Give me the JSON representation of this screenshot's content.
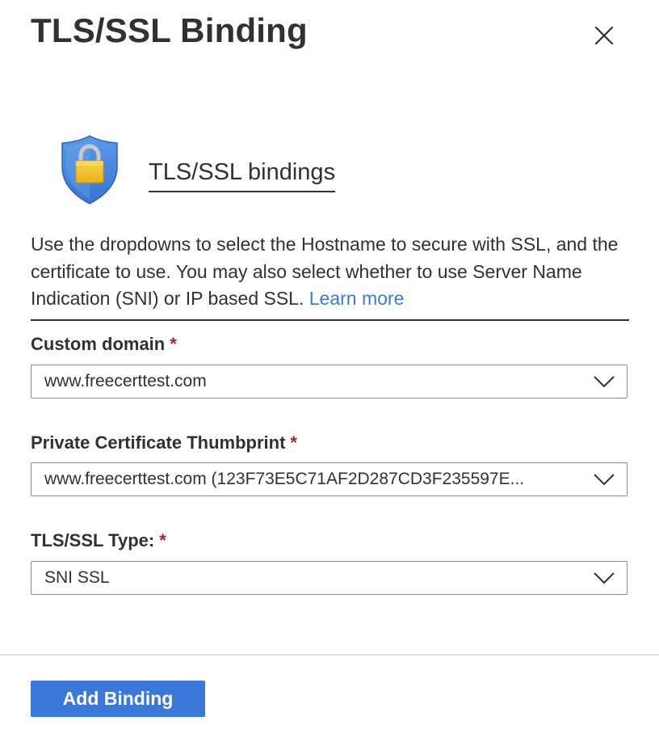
{
  "header": {
    "title": "TLS/SSL Binding",
    "close_icon": "close-icon"
  },
  "section": {
    "icon": "shield-lock-icon",
    "title": "TLS/SSL bindings",
    "description": "Use the dropdowns to select the Hostname to secure with SSL, and the certificate to use. You may also select whether to use Server Name Indication (SNI) or IP based SSL.",
    "learn_more": "Learn more"
  },
  "fields": {
    "custom_domain": {
      "label": "Custom domain",
      "required": "*",
      "value": "www.freecerttest.com"
    },
    "thumbprint": {
      "label": "Private Certificate Thumbprint",
      "required": "*",
      "value": "www.freecerttest.com (123F73E5C71AF2D287CD3F235597E..."
    },
    "ssl_type": {
      "label": "TLS/SSL Type:",
      "required": "*",
      "value": "SNI SSL"
    }
  },
  "footer": {
    "add_binding_label": "Add Binding"
  },
  "colors": {
    "primary": "#3b78d8",
    "link": "#3a7bd5",
    "required": "#a4262c",
    "text": "#323130",
    "shield": "#4a8be0",
    "lock": "#f2c12e"
  }
}
